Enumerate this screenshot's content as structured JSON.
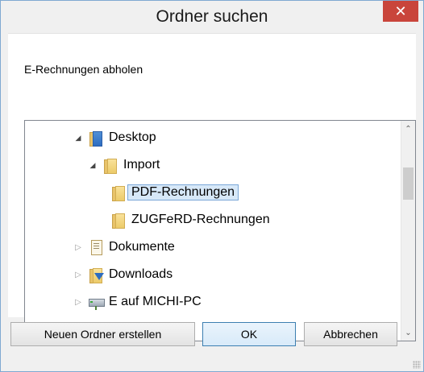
{
  "window": {
    "title": "Ordner suchen",
    "close_label": "✕"
  },
  "instruction": "E-Rechnungen abholen",
  "tree": {
    "items": [
      {
        "label": "Desktop",
        "icon": "desktop-folder-icon",
        "expanded": true,
        "level": 0
      },
      {
        "label": "Import",
        "icon": "folder-icon",
        "expanded": true,
        "level": 1
      },
      {
        "label": "PDF-Rechnungen",
        "icon": "folder-icon",
        "selected": true,
        "level": 2
      },
      {
        "label": "ZUGFeRD-Rechnungen",
        "icon": "folder-icon",
        "level": 2
      },
      {
        "label": "Dokumente",
        "icon": "documents-icon",
        "expanded": false,
        "level": 0
      },
      {
        "label": "Downloads",
        "icon": "downloads-icon",
        "expanded": false,
        "level": 0
      },
      {
        "label": "E auf MICHI-PC",
        "icon": "network-drive-icon",
        "expanded": false,
        "level": 0
      }
    ]
  },
  "buttons": {
    "new_folder": "Neuen Ordner erstellen",
    "ok": "OK",
    "cancel": "Abbrechen"
  },
  "colors": {
    "close_button": "#c9453b",
    "selection_border": "#7aa7d8",
    "selection_fill": "#d7e8f8",
    "default_button_border": "#3c7fb1"
  }
}
